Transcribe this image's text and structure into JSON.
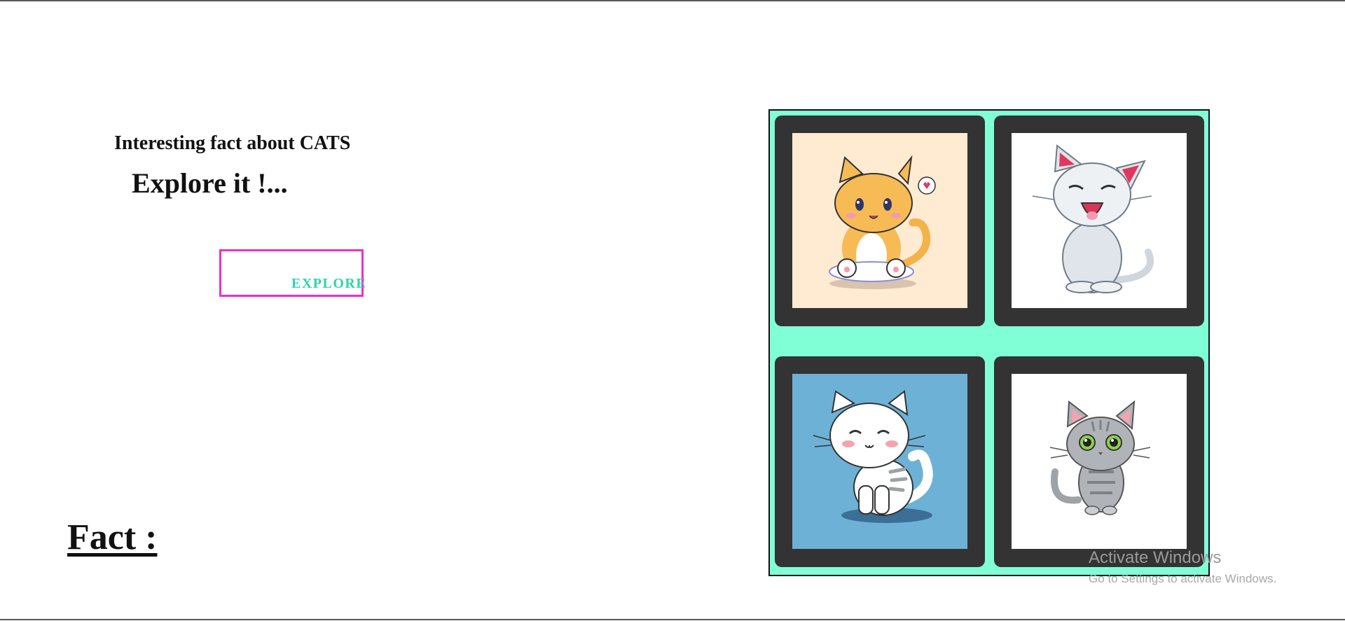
{
  "hero": {
    "subtitle": "Interesting fact about CATS",
    "title": "Explore it !...",
    "button_label": "EXPLORE"
  },
  "fact": {
    "heading": "Fact :"
  },
  "gallery": {
    "cards": [
      {
        "icon": "orange-kitten-illustration",
        "background": "#ffebd2"
      },
      {
        "icon": "gray-laughing-cat-illustration",
        "background": "#ffffff"
      },
      {
        "icon": "white-smiling-cat-illustration",
        "background": "#6eb1d6"
      },
      {
        "icon": "gray-green-eyed-kitten-illustration",
        "background": "#ffffff"
      }
    ]
  },
  "watermark": {
    "title": "Activate Windows",
    "subtitle": "Go to Settings to activate Windows."
  },
  "colors": {
    "button_border": "#ee2fc9",
    "button_text": "#2ed3ad",
    "gallery_background": "#80ffd6",
    "card_frame": "#333333"
  }
}
